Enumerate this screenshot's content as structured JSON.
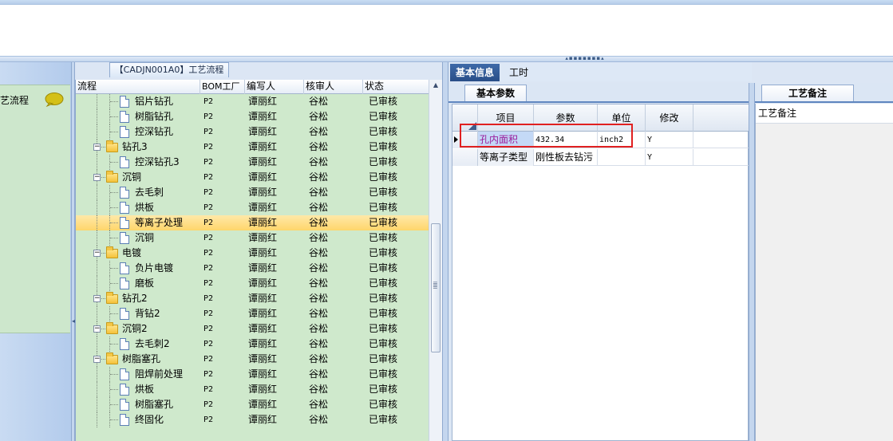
{
  "process_tab": {
    "label": "【CADJN001A0】工艺流程"
  },
  "left_panel": {
    "label": "艺流程"
  },
  "tree": {
    "columns": [
      "流程",
      "BOM工厂",
      "编写人",
      "核审人",
      "状态"
    ],
    "rows": [
      {
        "name": "铝片钻孔",
        "level": 2,
        "type": "doc",
        "bom": "P2",
        "writer": "谭丽红",
        "reviewer": "谷松",
        "status": "已审核"
      },
      {
        "name": "树脂钻孔",
        "level": 2,
        "type": "doc",
        "bom": "P2",
        "writer": "谭丽红",
        "reviewer": "谷松",
        "status": "已审核"
      },
      {
        "name": "控深钻孔",
        "level": 2,
        "type": "doc",
        "bom": "P2",
        "writer": "谭丽红",
        "reviewer": "谷松",
        "status": "已审核"
      },
      {
        "name": "钻孔3",
        "level": 1,
        "type": "folder",
        "bom": "P2",
        "writer": "谭丽红",
        "reviewer": "谷松",
        "status": "已审核"
      },
      {
        "name": "控深钻孔3",
        "level": 2,
        "type": "doc",
        "bom": "P2",
        "writer": "谭丽红",
        "reviewer": "谷松",
        "status": "已审核"
      },
      {
        "name": "沉铜",
        "level": 1,
        "type": "folder",
        "bom": "P2",
        "writer": "谭丽红",
        "reviewer": "谷松",
        "status": "已审核"
      },
      {
        "name": "去毛刺",
        "level": 2,
        "type": "doc",
        "bom": "P2",
        "writer": "谭丽红",
        "reviewer": "谷松",
        "status": "已审核"
      },
      {
        "name": "烘板",
        "level": 2,
        "type": "doc",
        "bom": "P2",
        "writer": "谭丽红",
        "reviewer": "谷松",
        "status": "已审核"
      },
      {
        "name": "等离子处理",
        "level": 2,
        "type": "doc",
        "bom": "P2",
        "writer": "谭丽红",
        "reviewer": "谷松",
        "status": "已审核",
        "selected": true
      },
      {
        "name": "沉铜",
        "level": 2,
        "type": "doc",
        "bom": "P2",
        "writer": "谭丽红",
        "reviewer": "谷松",
        "status": "已审核"
      },
      {
        "name": "电镀",
        "level": 1,
        "type": "folder",
        "bom": "P2",
        "writer": "谭丽红",
        "reviewer": "谷松",
        "status": "已审核"
      },
      {
        "name": "负片电镀",
        "level": 2,
        "type": "doc",
        "bom": "P2",
        "writer": "谭丽红",
        "reviewer": "谷松",
        "status": "已审核"
      },
      {
        "name": "磨板",
        "level": 2,
        "type": "doc",
        "bom": "P2",
        "writer": "谭丽红",
        "reviewer": "谷松",
        "status": "已审核"
      },
      {
        "name": "钻孔2",
        "level": 1,
        "type": "folder",
        "bom": "P2",
        "writer": "谭丽红",
        "reviewer": "谷松",
        "status": "已审核"
      },
      {
        "name": "背钻2",
        "level": 2,
        "type": "doc",
        "bom": "P2",
        "writer": "谭丽红",
        "reviewer": "谷松",
        "status": "已审核"
      },
      {
        "name": "沉铜2",
        "level": 1,
        "type": "folder",
        "bom": "P2",
        "writer": "谭丽红",
        "reviewer": "谷松",
        "status": "已审核"
      },
      {
        "name": "去毛刺2",
        "level": 2,
        "type": "doc",
        "bom": "P2",
        "writer": "谭丽红",
        "reviewer": "谷松",
        "status": "已审核"
      },
      {
        "name": "树脂塞孔",
        "level": 1,
        "type": "folder",
        "bom": "P2",
        "writer": "谭丽红",
        "reviewer": "谷松",
        "status": "已审核"
      },
      {
        "name": "阻焊前处理",
        "level": 2,
        "type": "doc",
        "bom": "P2",
        "writer": "谭丽红",
        "reviewer": "谷松",
        "status": "已审核"
      },
      {
        "name": "烘板",
        "level": 2,
        "type": "doc",
        "bom": "P2",
        "writer": "谭丽红",
        "reviewer": "谷松",
        "status": "已审核"
      },
      {
        "name": "树脂塞孔",
        "level": 2,
        "type": "doc",
        "bom": "P2",
        "writer": "谭丽红",
        "reviewer": "谷松",
        "status": "已审核"
      },
      {
        "name": "终固化",
        "level": 2,
        "type": "doc",
        "bom": "P2",
        "writer": "谭丽红",
        "reviewer": "谷松",
        "status": "已审核"
      }
    ]
  },
  "middle_panel": {
    "tabs": [
      "基本信息",
      "工时"
    ],
    "subtab": "基本参数",
    "columns": [
      "项目",
      "参数",
      "单位",
      "修改"
    ],
    "rows": [
      {
        "item": "孔内面积",
        "param": "432.34",
        "unit": "inch2",
        "modify": "Y"
      },
      {
        "item": "等离子类型",
        "param": "刚性板去钻污",
        "unit": "",
        "modify": "Y"
      }
    ]
  },
  "right_panel": {
    "tab": "工艺备注",
    "header": "工艺备注"
  },
  "colors": {
    "tree_bg": "#cfe9cc",
    "selected_row": "#ffd66b",
    "active_tab": "#294e88",
    "highlight_box": "#e02020"
  }
}
